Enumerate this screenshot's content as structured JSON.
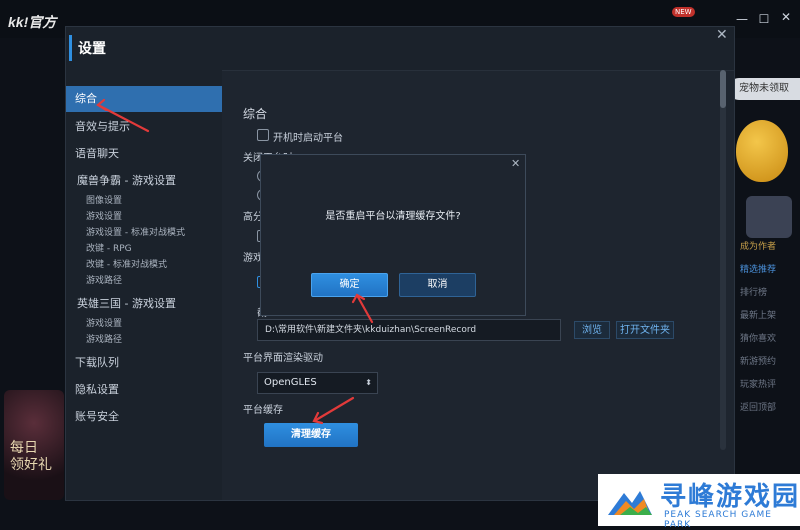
{
  "app": {
    "logo_text": "kk!官方",
    "new_badge": "NEW"
  },
  "right_panel": {
    "pet_tag": "宠物未领取",
    "menu": [
      "成为作者",
      "精选推荐",
      "排行榜",
      "最新上架",
      "猜你喜欢",
      "新游预约",
      "玩家热评",
      "返回顶部"
    ]
  },
  "promo": {
    "text_line1": "每日",
    "text_line2": "领好礼"
  },
  "settings": {
    "title": "设置",
    "nav_main": [
      "综合",
      "音效与提示",
      "语音聊天",
      "魔兽争霸 - 游戏设置"
    ],
    "nav_sub_warcraft": [
      "图像设置",
      "游戏设置",
      "游戏设置 - 标准对战模式",
      "改键 - RPG",
      "改键 - 标准对战模式",
      "游戏路径"
    ],
    "nav_hero": "英雄三国 - 游戏设置",
    "nav_sub_hero": [
      "游戏设置",
      "游戏路径"
    ],
    "nav_bottom": [
      "下载队列",
      "隐私设置",
      "账号安全"
    ],
    "content": {
      "section_title": "综合",
      "autostart_label": "开机时启动平台",
      "close_label_partial": "关闭平台时",
      "high_label_partial": "高分",
      "game_label_partial": "游戏",
      "path_label_partial": "截",
      "path_value": "D:\\常用软件\\新建文件夹\\kkduizhan\\ScreenRecord",
      "browse": "浏览",
      "open_folder": "打开文件夹",
      "render_label": "平台界面渲染驱动",
      "render_value": "OpenGLES",
      "cache_label": "平台缓存",
      "clear_cache": "清理缓存"
    }
  },
  "dialog": {
    "message": "是否重启平台以清理缓存文件?",
    "ok": "确定",
    "cancel": "取消"
  },
  "watermark": {
    "title": "寻峰游戏园",
    "subtitle": "PEAK SEARCH GAME PARK"
  },
  "colors": {
    "accent": "#2f8fe0",
    "annotation_arrow": "#e23a3a",
    "nav_active": "#2f6faf"
  }
}
